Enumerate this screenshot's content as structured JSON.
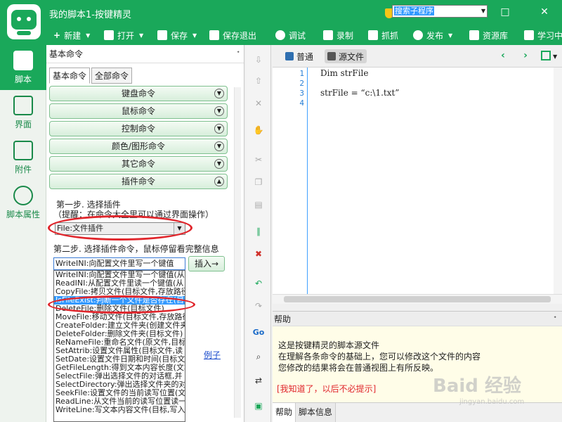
{
  "window": {
    "title": "我的脚本1-按键精灵",
    "badge": "神盾",
    "controls": [
      "gear-icon",
      "minimize-icon",
      "maximize-icon",
      "close-icon"
    ]
  },
  "toolbar": {
    "new": "新建",
    "open": "打开",
    "save": "保存",
    "save_exit": "保存退出",
    "debug": "调试",
    "record": "录制",
    "capture": "抓抓",
    "publish": "发布",
    "resource": "资源库",
    "learn": "学习中"
  },
  "leftnav": {
    "items": [
      {
        "label": "脚本",
        "icon": "script-icon"
      },
      {
        "label": "界面",
        "icon": "ui-icon"
      },
      {
        "label": "附件",
        "icon": "attachment-icon"
      },
      {
        "label": "脚本属性",
        "icon": "info-icon"
      }
    ]
  },
  "cmdpanel": {
    "title": "基本命令",
    "pin": "ᐩ",
    "tabs": [
      "基本命令",
      "全部命令"
    ],
    "categories": [
      "键盘命令",
      "鼠标命令",
      "控制命令",
      "颜色/图形命令",
      "其它命令",
      "插件命令"
    ],
    "step1_label": "第一步. 选择插件",
    "step1_hint": "（提醒：在命令大全里可以通过界面操作）",
    "plugin_selected": "File:文件插件",
    "step2_label": "第二步. 选择插件命令，鼠标停留看完整信息",
    "command_selected": "WriteINI:向配置文件里写一个键值",
    "insert_label": "插入→",
    "example_label": "例子",
    "dropdown_items": [
      "WriteINI:向配置文件里写一个键值(从",
      "ReadINI:从配置文件里读一个键值(从",
      "CopyFile:拷贝文件(目标文件,存放路径",
      "IsFileExist:判断一个文件是否存在(目标",
      "DeleteFile:删除文件(目标文件)",
      "MoveFile:移动文件(目标文件,存放路径",
      "CreateFolder:建立文件夹(创建文件夹",
      "DeleteFolder:删除文件夹(目标文件)",
      "ReNameFile:重命名文件(原文件,目标",
      "SetAttrib:设置文件属性(目标文件,读",
      "SetDate:设置文件日期和时间(目标文",
      "GetFileLength:得到文本内容长度(文本",
      "SelectFile:弹出选择文件的对话框,并",
      "SelectDirectory:弹出选择文件夹的对",
      "SeekFile:设置文件的当前读写位置(文",
      "ReadLine:从文件当前的读写位置读一",
      "WriteLine:写文本内容文件(目标,写入"
    ],
    "selected_index": 3
  },
  "editor": {
    "view_normal": "普通",
    "view_source": "源文件",
    "search_value": "搜索子程序",
    "lines": [
      {
        "no": "1",
        "code": "Dim strFile"
      },
      {
        "no": "2",
        "code": ""
      },
      {
        "no": "3",
        "code": "strFile = “c:\\1.txt”"
      },
      {
        "no": "4",
        "code": ""
      }
    ]
  },
  "help": {
    "title": "帮助",
    "pin": "ᐩ",
    "lines": [
      "这是按键精灵的脚本源文件",
      "在理解各条命令的基础上，您可以修改这个文件的内容",
      "您修改的结果将会在普通视图上有所反映。"
    ],
    "dismiss": "[我知道了，以后不必提示]",
    "tabs": [
      "帮助",
      "脚本信息"
    ]
  },
  "watermark": {
    "brand": "Baid 经验",
    "url": "jingyan.baidu.com"
  },
  "colors": {
    "accent": "#1aa85a",
    "highlight": "#3399ff",
    "annotation": "#e0262c"
  }
}
